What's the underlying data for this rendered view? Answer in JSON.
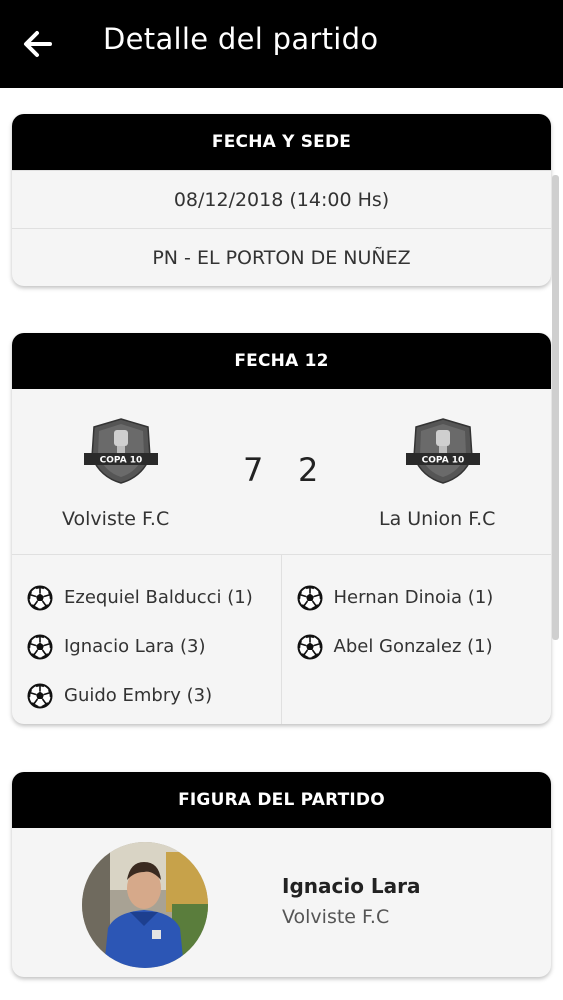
{
  "header": {
    "title": "Detalle del partido"
  },
  "venue_card": {
    "title": "FECHA Y SEDE",
    "date": "08/12/2018 (14:00 Hs)",
    "venue": "PN - EL PORTON DE NUÑEZ"
  },
  "match_card": {
    "title": "FECHA 12",
    "home": {
      "name": "Volviste F.C",
      "score": "7",
      "logo_text": "COPA 10"
    },
    "away": {
      "name": "La Union F.C",
      "score": "2",
      "logo_text": "COPA 10"
    },
    "home_scorers": [
      {
        "label": "Ezequiel Balducci (1)"
      },
      {
        "label": "Ignacio Lara (3)"
      },
      {
        "label": "Guido Embry (3)"
      }
    ],
    "away_scorers": [
      {
        "label": "Hernan Dinoia (1)"
      },
      {
        "label": "Abel Gonzalez (1)"
      }
    ]
  },
  "figure_card": {
    "title": "FIGURA DEL PARTIDO",
    "player": "Ignacio Lara",
    "team": "Volviste F.C"
  },
  "icons": {
    "back": "arrow-left-icon",
    "ball": "soccer-ball-icon",
    "logo": "copa-10-logo"
  },
  "colors": {
    "header_bg": "#000000",
    "card_bg": "#f5f5f5",
    "text": "#333333"
  }
}
